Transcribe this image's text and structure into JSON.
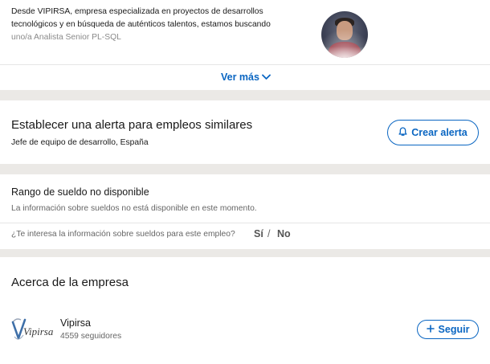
{
  "description": {
    "lines": [
      "Desde VIPIRSA, empresa especializada en proyectos de desarrollos",
      "tecnológicos y en búsqueda de auténticos talentos, estamos buscando",
      "uno/a Analista Senior PL-SQL"
    ],
    "see_more_label": "Ver más"
  },
  "alert": {
    "title": "Establecer una alerta para empleos similares",
    "subtitle": "Jefe de equipo de desarrollo, España",
    "button_label": "Crear alerta"
  },
  "salary": {
    "title": "Rango de sueldo no disponible",
    "note": "La información sobre sueldos no está disponible en este momento.",
    "question": "¿Te interesa la información sobre sueldos para este empleo?",
    "yes_label": "Sí",
    "separator": "/",
    "no_label": "No"
  },
  "company": {
    "heading": "Acerca de la empresa",
    "logo_text": "Vipirsa",
    "name": "Vipirsa",
    "followers": "4559 seguidores",
    "follow_label": "Seguir"
  },
  "colors": {
    "accent": "#0a66c2",
    "background": "#ebe9e6",
    "card": "#ffffff"
  },
  "icons": {
    "see_more": "chevron-down-icon",
    "alert": "bell-icon",
    "follow": "plus-icon"
  }
}
